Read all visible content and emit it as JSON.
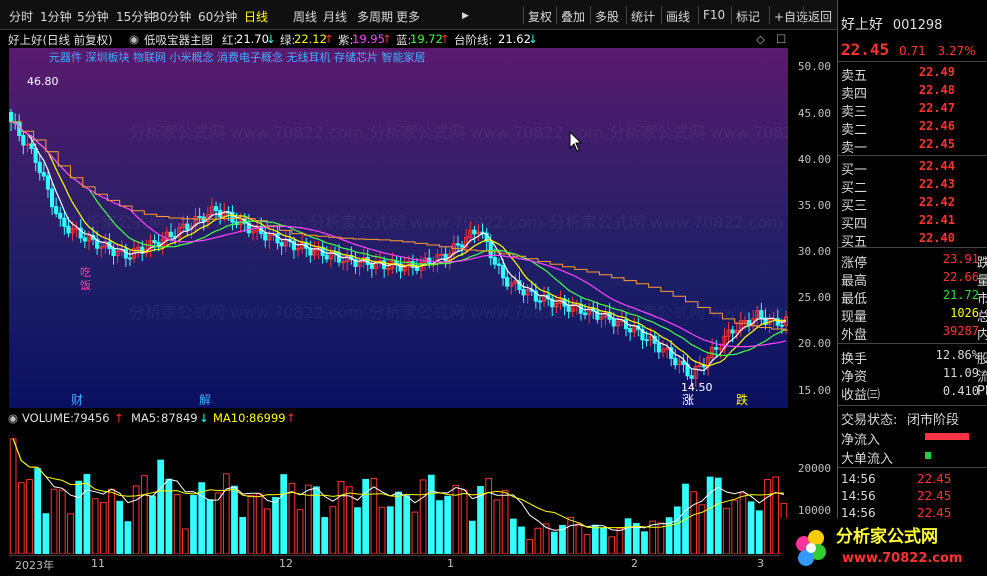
{
  "toolbar": {
    "left_items": [
      "分时",
      "1分钟",
      "5分钟",
      "15分钟",
      "30分钟",
      "60分钟",
      "日线",
      "周线",
      "月线",
      "多周期",
      "更多"
    ],
    "active": "日线",
    "more_arrow": "▶",
    "right_items": [
      "复权",
      "叠加",
      "多股",
      "统计",
      "画线",
      "F10",
      "标记",
      "+自选",
      "返回"
    ]
  },
  "chart_header": {
    "stock_label": "好上好(日线 前复权)",
    "indicator_name": "低吸宝器主图",
    "items": [
      {
        "name": "红:",
        "value": "21.70",
        "arrow": "↓",
        "color": "#ffffff"
      },
      {
        "name": "绿:",
        "value": "22.12",
        "arrow": "↑",
        "color": "#ffff00"
      },
      {
        "name": "紫:",
        "value": "19.95",
        "arrow": "↑",
        "color": "#ff44ff"
      },
      {
        "name": "蓝:",
        "value": "19.72",
        "arrow": "↑",
        "color": "#44ff44"
      },
      {
        "name": "台阶线:",
        "value": "21.62",
        "arrow": "↓",
        "color": "#ffffff"
      }
    ],
    "concepts": "元器件 深圳板块 物联网 小米概念 消费电子概念 无线耳机 存储芯片 智能家居"
  },
  "main_chart": {
    "y_ticks": [
      "50.00",
      "45.00",
      "40.00",
      "35.00",
      "30.00",
      "25.00",
      "20.00",
      "15.00"
    ],
    "high_label": "46.80",
    "low_label": "14.50",
    "markers": [
      {
        "text": "财",
        "color": "#44aaff"
      },
      {
        "text": "解",
        "color": "#44aaff"
      },
      {
        "text": "涨",
        "color": "#ffffff"
      },
      {
        "text": "跌",
        "color": "#ffff00"
      }
    ],
    "signal_text": [
      "吃",
      "饭"
    ],
    "watermark": "分析家公式网 www.70822.com"
  },
  "quote": {
    "name": "好上好",
    "code": "001298",
    "price": "22.45",
    "change": "0.71",
    "change_pct": "3.27%",
    "asks": [
      {
        "label": "卖五",
        "price": "22.49"
      },
      {
        "label": "卖四",
        "price": "22.48"
      },
      {
        "label": "卖三",
        "price": "22.47"
      },
      {
        "label": "卖二",
        "price": "22.46"
      },
      {
        "label": "卖一",
        "price": "22.45"
      }
    ],
    "bids": [
      {
        "label": "买一",
        "price": "22.44"
      },
      {
        "label": "买二",
        "price": "22.43"
      },
      {
        "label": "买三",
        "price": "22.42"
      },
      {
        "label": "买四",
        "price": "22.41"
      },
      {
        "label": "买五",
        "price": "22.40"
      }
    ],
    "stats": [
      {
        "label": "涨停",
        "value": "23.91",
        "color": "#ff3333",
        "extra": "跌停"
      },
      {
        "label": "最高",
        "value": "22.66",
        "color": "#ff3333",
        "extra": "量比"
      },
      {
        "label": "最低",
        "value": "21.72",
        "color": "#33dd33",
        "extra": "市值"
      },
      {
        "label": "现量",
        "value": "1026",
        "color": "#ffff00",
        "extra": "总量"
      },
      {
        "label": "外盘",
        "value": "39287",
        "color": "#ff3333",
        "extra": "内盘"
      }
    ],
    "stats2": [
      {
        "label": "换手",
        "value": "12.86%",
        "color": "#d8d8d8",
        "extra": "股本"
      },
      {
        "label": "净资",
        "value": "11.09",
        "color": "#d8d8d8",
        "extra": "流通"
      },
      {
        "label": "收益㈢",
        "value": "0.410",
        "color": "#d8d8d8",
        "extra": "PE"
      }
    ],
    "trade_status_label": "交易状态:",
    "trade_status_value": "闭市阶段",
    "net_inflow_label": "净流入",
    "big_inflow_label": "大单流入",
    "ticks": [
      {
        "time": "14:56",
        "price": "22.45"
      },
      {
        "time": "14:56",
        "price": "22.45"
      },
      {
        "time": "14:56",
        "price": "22.45"
      }
    ]
  },
  "volume": {
    "label": "VOLUME:",
    "value": "79456",
    "value_arrow": "↑",
    "ma5_label": "MA5:",
    "ma5_value": "87849",
    "ma5_arrow": "↓",
    "ma10_label": "MA10:",
    "ma10_value": "86999",
    "ma10_arrow": "↑",
    "y_ticks": [
      "20000",
      "10000"
    ]
  },
  "x_axis": {
    "labels": [
      "2023年",
      "11",
      "12",
      "1",
      "2",
      "3"
    ]
  },
  "logo": {
    "title": "分析家公式网",
    "url": "www.70822.com"
  },
  "colors": {
    "up": "#ff3333",
    "down": "#33ffff",
    "ma_white": "#ffffff",
    "ma_yellow": "#ffff00",
    "step_line": "#ff9933",
    "accent": "#ffff00"
  },
  "chart_data": {
    "type": "candlestick",
    "high": 46.8,
    "low": 14.5,
    "last_close": 22.45,
    "y_range": [
      13,
      52
    ],
    "volume_y_range": [
      0,
      30000
    ]
  }
}
